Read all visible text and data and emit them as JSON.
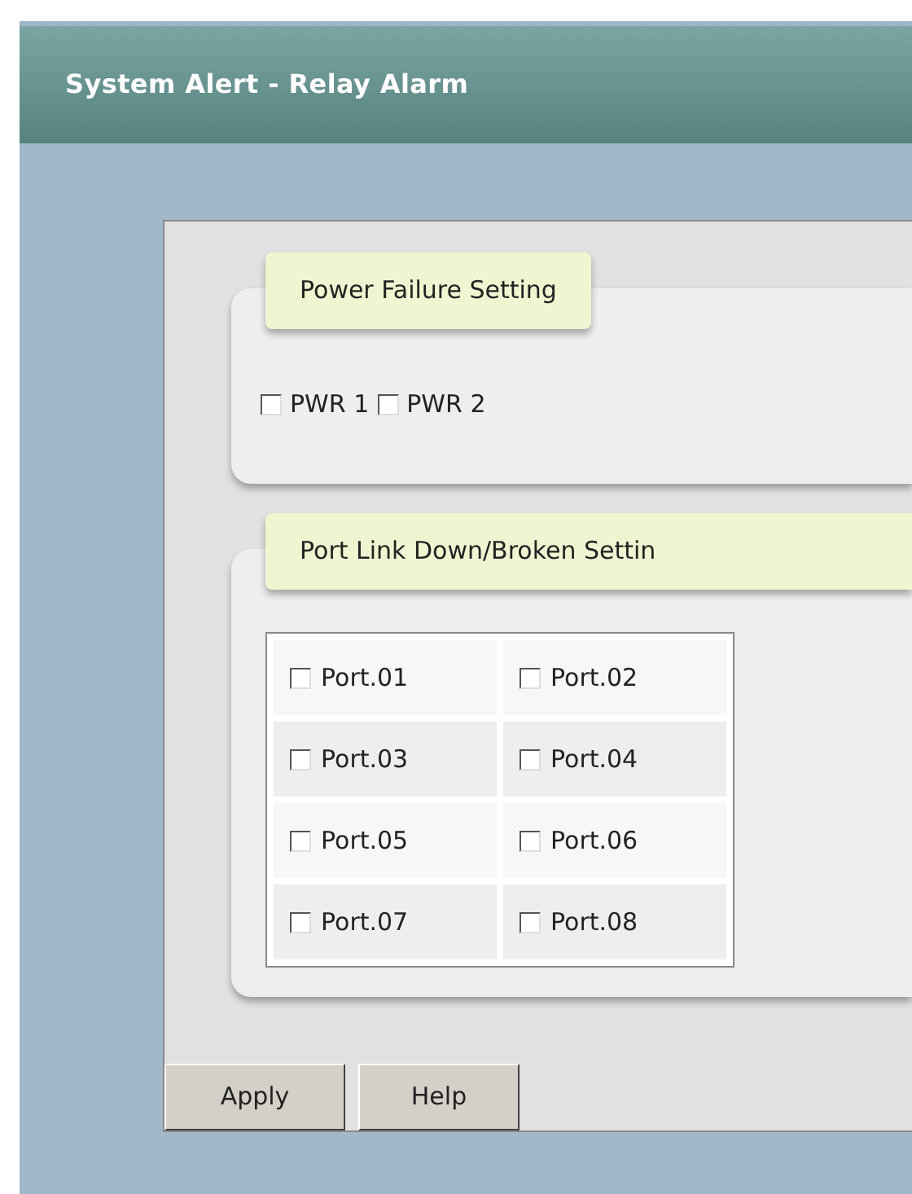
{
  "window": {
    "title": "System Alert - Relay Alarm"
  },
  "power_failure": {
    "legend": "Power Failure Setting",
    "options": [
      {
        "label": "PWR 1",
        "checked": false
      },
      {
        "label": "PWR 2",
        "checked": false
      }
    ]
  },
  "port_link": {
    "legend": "Port Link Down/Broken Settin",
    "ports": [
      {
        "label": "Port.01",
        "checked": false
      },
      {
        "label": "Port.02",
        "checked": false
      },
      {
        "label": "Port.03",
        "checked": false
      },
      {
        "label": "Port.04",
        "checked": false
      },
      {
        "label": "Port.05",
        "checked": false
      },
      {
        "label": "Port.06",
        "checked": false
      },
      {
        "label": "Port.07",
        "checked": false
      },
      {
        "label": "Port.08",
        "checked": false
      }
    ]
  },
  "buttons": [
    "Apply",
    "Help"
  ]
}
